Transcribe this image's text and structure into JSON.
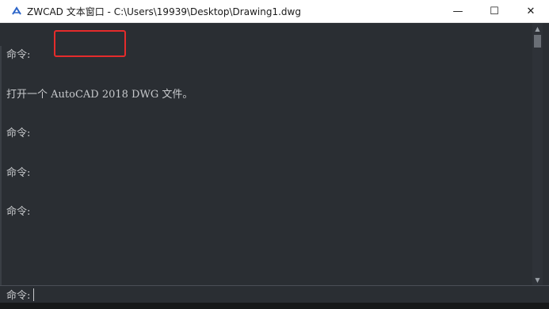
{
  "window": {
    "title": "ZWCAD 文本窗口 - C:\\Users\\19939\\Desktop\\Drawing1.dwg",
    "app_icon": "zwcad-logo-icon",
    "controls": {
      "minimize": "—",
      "maximize": "☐",
      "close": "✕"
    }
  },
  "history": [
    "命令:",
    "打开一个 AutoCAD 2018 DWG 文件。",
    "命令:",
    "命令:",
    "命令:"
  ],
  "command_line": {
    "prompt": "命令:",
    "value": ""
  },
  "colors": {
    "background": "#2a2e33",
    "text": "#c7c9cc",
    "highlight_box": "#e52b2b"
  }
}
